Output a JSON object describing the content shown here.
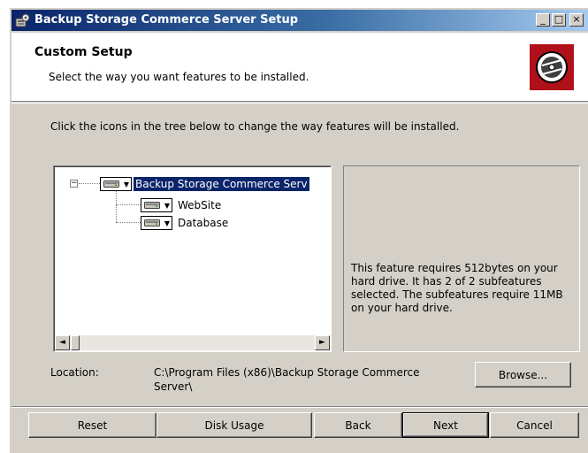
{
  "window": {
    "title": "Backup Storage Commerce Server Setup",
    "controls": {
      "minimize": "_",
      "maximize": "□",
      "close": "×"
    }
  },
  "banner": {
    "title": "Custom Setup",
    "subtitle": "Select the way you want features to be installed.",
    "icon": "disc-icon",
    "icon_color": "#b0101a"
  },
  "instruction": "Click the icons in the tree below to change the way features will be installed.",
  "tree": {
    "root": {
      "label": "Backup Storage Commerce Serv",
      "icon": "hard-drive-icon",
      "expander": "−"
    },
    "children": [
      {
        "label": "WebSite",
        "icon": "hard-drive-icon"
      },
      {
        "label": "Database",
        "icon": "hard-drive-icon"
      }
    ],
    "scroll_left": "◄",
    "scroll_right": "►"
  },
  "description": "This feature requires 512bytes on your hard drive. It has 2 of 2 subfeatures selected. The subfeatures require 11MB on your hard drive.",
  "location": {
    "label": "Location:",
    "path": "C:\\Program Files (x86)\\Backup Storage Commerce Server\\"
  },
  "buttons": {
    "browse": "Browse...",
    "reset": "Reset",
    "disk_usage": "Disk Usage",
    "back": "Back",
    "next": "Next",
    "cancel": "Cancel"
  },
  "colors": {
    "titlebar_start": "#0a246a",
    "titlebar_end": "#a6caf0",
    "dialog_bg": "#d4d0c8",
    "selection": "#0a246a"
  }
}
